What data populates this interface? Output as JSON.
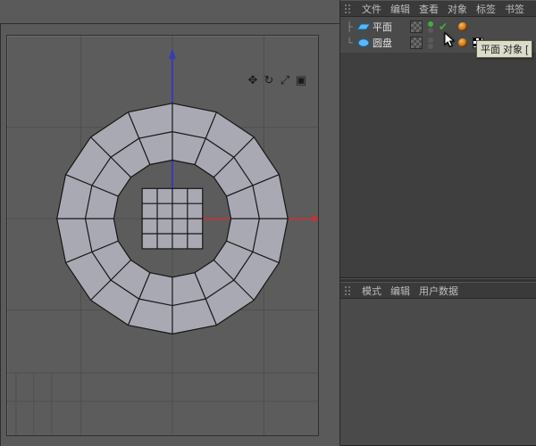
{
  "viewport": {
    "nav_icons": [
      "move-icon",
      "rotate-icon",
      "zoom-icon",
      "frame-icon"
    ]
  },
  "object_manager": {
    "menu": {
      "file": "文件",
      "edit": "编辑",
      "view": "查看",
      "objects": "对象",
      "tags": "标签",
      "bookmarks": "书签"
    },
    "items": [
      {
        "icon": "plane-icon",
        "label": "平面",
        "vis_green": true,
        "checked": true,
        "tag2": false
      },
      {
        "icon": "disc-icon",
        "label": "圆盘",
        "vis_green": false,
        "checked": false,
        "tag2": true
      }
    ],
    "tooltip": "平面 对象 ["
  },
  "attribute_manager": {
    "menu": {
      "mode": "模式",
      "edit": "编辑",
      "userdata": "用户数据"
    }
  },
  "colors": {
    "axis_x": "#b43a3a",
    "axis_y": "#3a3ab4",
    "mesh_fill": "#a9a9b3",
    "mesh_edge": "#161616",
    "grid": "#4f4f4f"
  }
}
